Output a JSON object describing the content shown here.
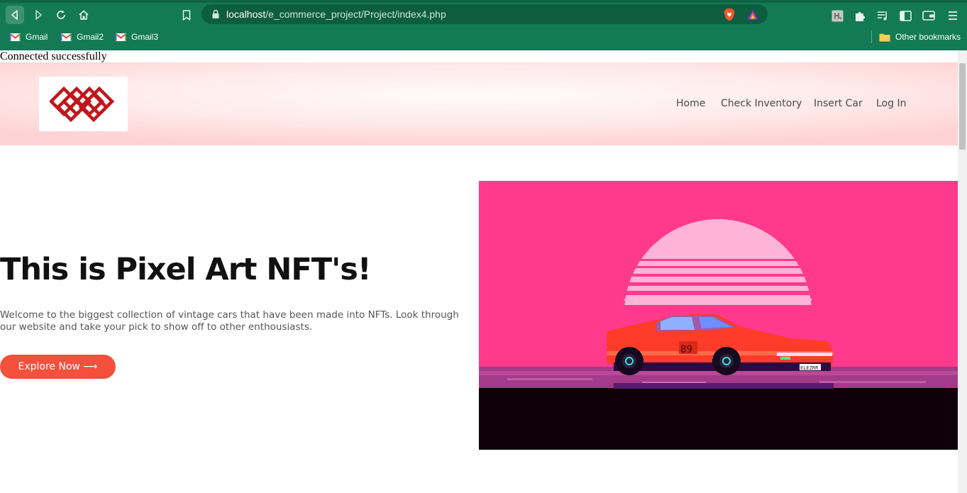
{
  "browser": {
    "url_host": "localhost",
    "url_path": "/e_commerce_project/Project/index4.php",
    "bookmarks": [
      {
        "label": "Gmail",
        "icon": "gmail-icon"
      },
      {
        "label": "Gmail2",
        "icon": "gmail-icon"
      },
      {
        "label": "Gmail3",
        "icon": "gmail-icon"
      }
    ],
    "other_bookmarks": "Other bookmarks",
    "theme_color": "#137a55"
  },
  "page": {
    "connection_message": "Connected successfully",
    "nav": {
      "items": [
        "Home",
        "Check Inventory",
        "Insert Car",
        "Log In"
      ]
    },
    "hero": {
      "title": "This is Pixel Art NFT's!",
      "description": "Welcome to the biggest collection of vintage cars that have been made into NFTs. Look through our website and take your pick to show off to other enthousiasts.",
      "cta_label": "Explore Now ⟶",
      "image": {
        "subject": "pixel-art-red-sports-car-sunset",
        "plate_text": "ELEZRR",
        "door_number": "89"
      }
    },
    "colors": {
      "cta": "#f4503c",
      "logo": "#c0161a",
      "art_background": "#ff3a8c"
    }
  }
}
